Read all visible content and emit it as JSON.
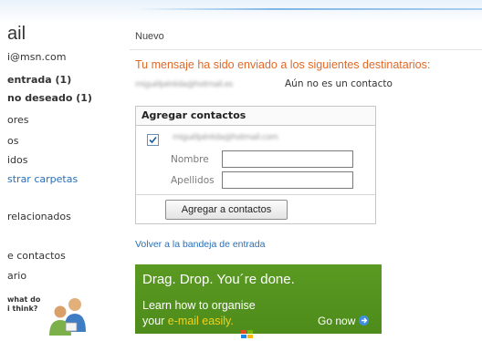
{
  "nav": {
    "brand": "ail",
    "account": "i@msn.com",
    "inbox": "entrada (1)",
    "junk": "no deseado (1)",
    "drafts": "ores",
    "sent": "os",
    "deleted": "idos",
    "show_folders": "strar carpetas",
    "related": "relacionados",
    "contacts": "e contactos",
    "calendar": "ario",
    "promo_line1": "what do",
    "promo_line2": "i think?"
  },
  "main": {
    "new_label": "Nuevo",
    "success_message": "Tu mensaje ha sido enviado a los siguientes destinatarios:",
    "recipient_blurred": "miguélpéréda@hotmail.es",
    "not_contact": "Aún no es un contacto",
    "add_contacts": {
      "title": "Agregar contactos",
      "email_blurred": "miguélpéréda@hotmail.com",
      "first_name_label": "Nombre",
      "last_name_label": "Apellidos",
      "first_name_value": "",
      "last_name_value": "",
      "button_label": "Agregar a contactos"
    },
    "back_link": "Volver a la bandeja de entrada",
    "ad": {
      "headline": "Drag. Drop. You´re done.",
      "line2": "Learn how to organise",
      "line3_prefix": "your ",
      "line3_highlight": "e-mail easily.",
      "cta": "Go now",
      "bg_color": "#4f8f1c",
      "highlight_color": "#f3d21b"
    }
  }
}
